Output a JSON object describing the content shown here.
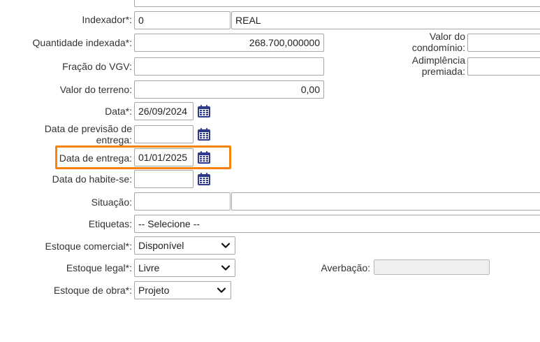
{
  "form": {
    "indexador": {
      "label": "Indexador*:",
      "code": "0",
      "name": "REAL"
    },
    "quantidade_indexada": {
      "label": "Quantidade indexada*:",
      "value": "268.700,000000"
    },
    "fracao_vgv": {
      "label": "Fração do VGV:",
      "value": ""
    },
    "valor_terreno": {
      "label": "Valor do terreno:",
      "value": "0,00"
    },
    "data": {
      "label": "Data*:",
      "value": "26/09/2024"
    },
    "data_previsao_entrega": {
      "label": "Data de previsão de entrega:",
      "value": ""
    },
    "data_entrega": {
      "label": "Data de entrega:",
      "value": "01/01/2025"
    },
    "data_habite_se": {
      "label": "Data do habite-se:",
      "value": ""
    },
    "situacao": {
      "label": "Situação:",
      "code": "",
      "description": ""
    },
    "etiquetas": {
      "label": "Etiquetas:",
      "value": "-- Selecione --"
    },
    "estoque_comercial": {
      "label": "Estoque comercial*:",
      "value": "Disponível"
    },
    "estoque_legal": {
      "label": "Estoque legal*:",
      "value": "Livre"
    },
    "estoque_obra": {
      "label": "Estoque de obra*:",
      "value": "Projeto"
    },
    "valor_condominio": {
      "label": "Valor do condomínio:",
      "value": ""
    },
    "adimplencia_premiada": {
      "label": "Adimplência premiada:",
      "value": ""
    },
    "averbacao": {
      "label": "Averbação:",
      "value": ""
    }
  },
  "colors": {
    "highlight": "#f5830d",
    "calendar_icon": "#2d3a8c",
    "field_border": "#a6a6a6"
  },
  "icons": {
    "calendar": "calendar-icon",
    "dropdown": "chevron-down-icon"
  }
}
